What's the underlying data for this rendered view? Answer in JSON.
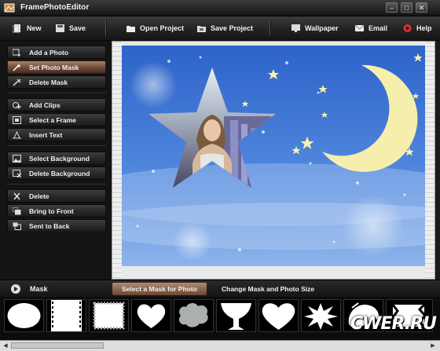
{
  "app": {
    "title": "FramePhotoEditor"
  },
  "window_controls": {
    "minimize": "–",
    "maximize": "□",
    "close": "✕"
  },
  "toolbar": {
    "new": "New",
    "save": "Save",
    "open_project": "Open Project",
    "save_project": "Save Project",
    "wallpaper": "Wallpaper",
    "email": "Email",
    "help": "Help"
  },
  "sidebar": {
    "items": [
      {
        "label": "Add a Photo",
        "icon": "add-photo-icon"
      },
      {
        "label": "Set Photo Mask",
        "icon": "mask-wand-icon",
        "active": true
      },
      {
        "label": "Delete Mask",
        "icon": "delete-mask-icon"
      },
      {
        "label": "Add Clips",
        "icon": "add-clips-icon"
      },
      {
        "label": "Select a Frame",
        "icon": "frame-icon"
      },
      {
        "label": "Insert Text",
        "icon": "text-icon"
      },
      {
        "label": "Select Background",
        "icon": "background-icon"
      },
      {
        "label": "Delete Background",
        "icon": "delete-background-icon"
      },
      {
        "label": "Delete",
        "icon": "delete-x-icon"
      },
      {
        "label": "Bring to Front",
        "icon": "bring-front-icon"
      },
      {
        "label": "Sent to Back",
        "icon": "send-back-icon"
      }
    ]
  },
  "bottom": {
    "mask_label": "Mask",
    "tabs": [
      {
        "label": "Select a Mask for Photo",
        "active": true
      },
      {
        "label": "Change Mask and Photo Size",
        "active": false
      }
    ]
  },
  "thumbnails": [
    "oval-mask",
    "film-strip-mask",
    "stamp-mask",
    "heart-mask",
    "cloud-mask",
    "goblet-mask",
    "heart-mask-2",
    "burst-mask",
    "splash-mask",
    "grunge-mask"
  ],
  "watermark": "CWER.RU",
  "colors": {
    "accent_active": "#8a6450",
    "sky_blue": "#3f6fd0",
    "moon": "#f3e8a0"
  }
}
